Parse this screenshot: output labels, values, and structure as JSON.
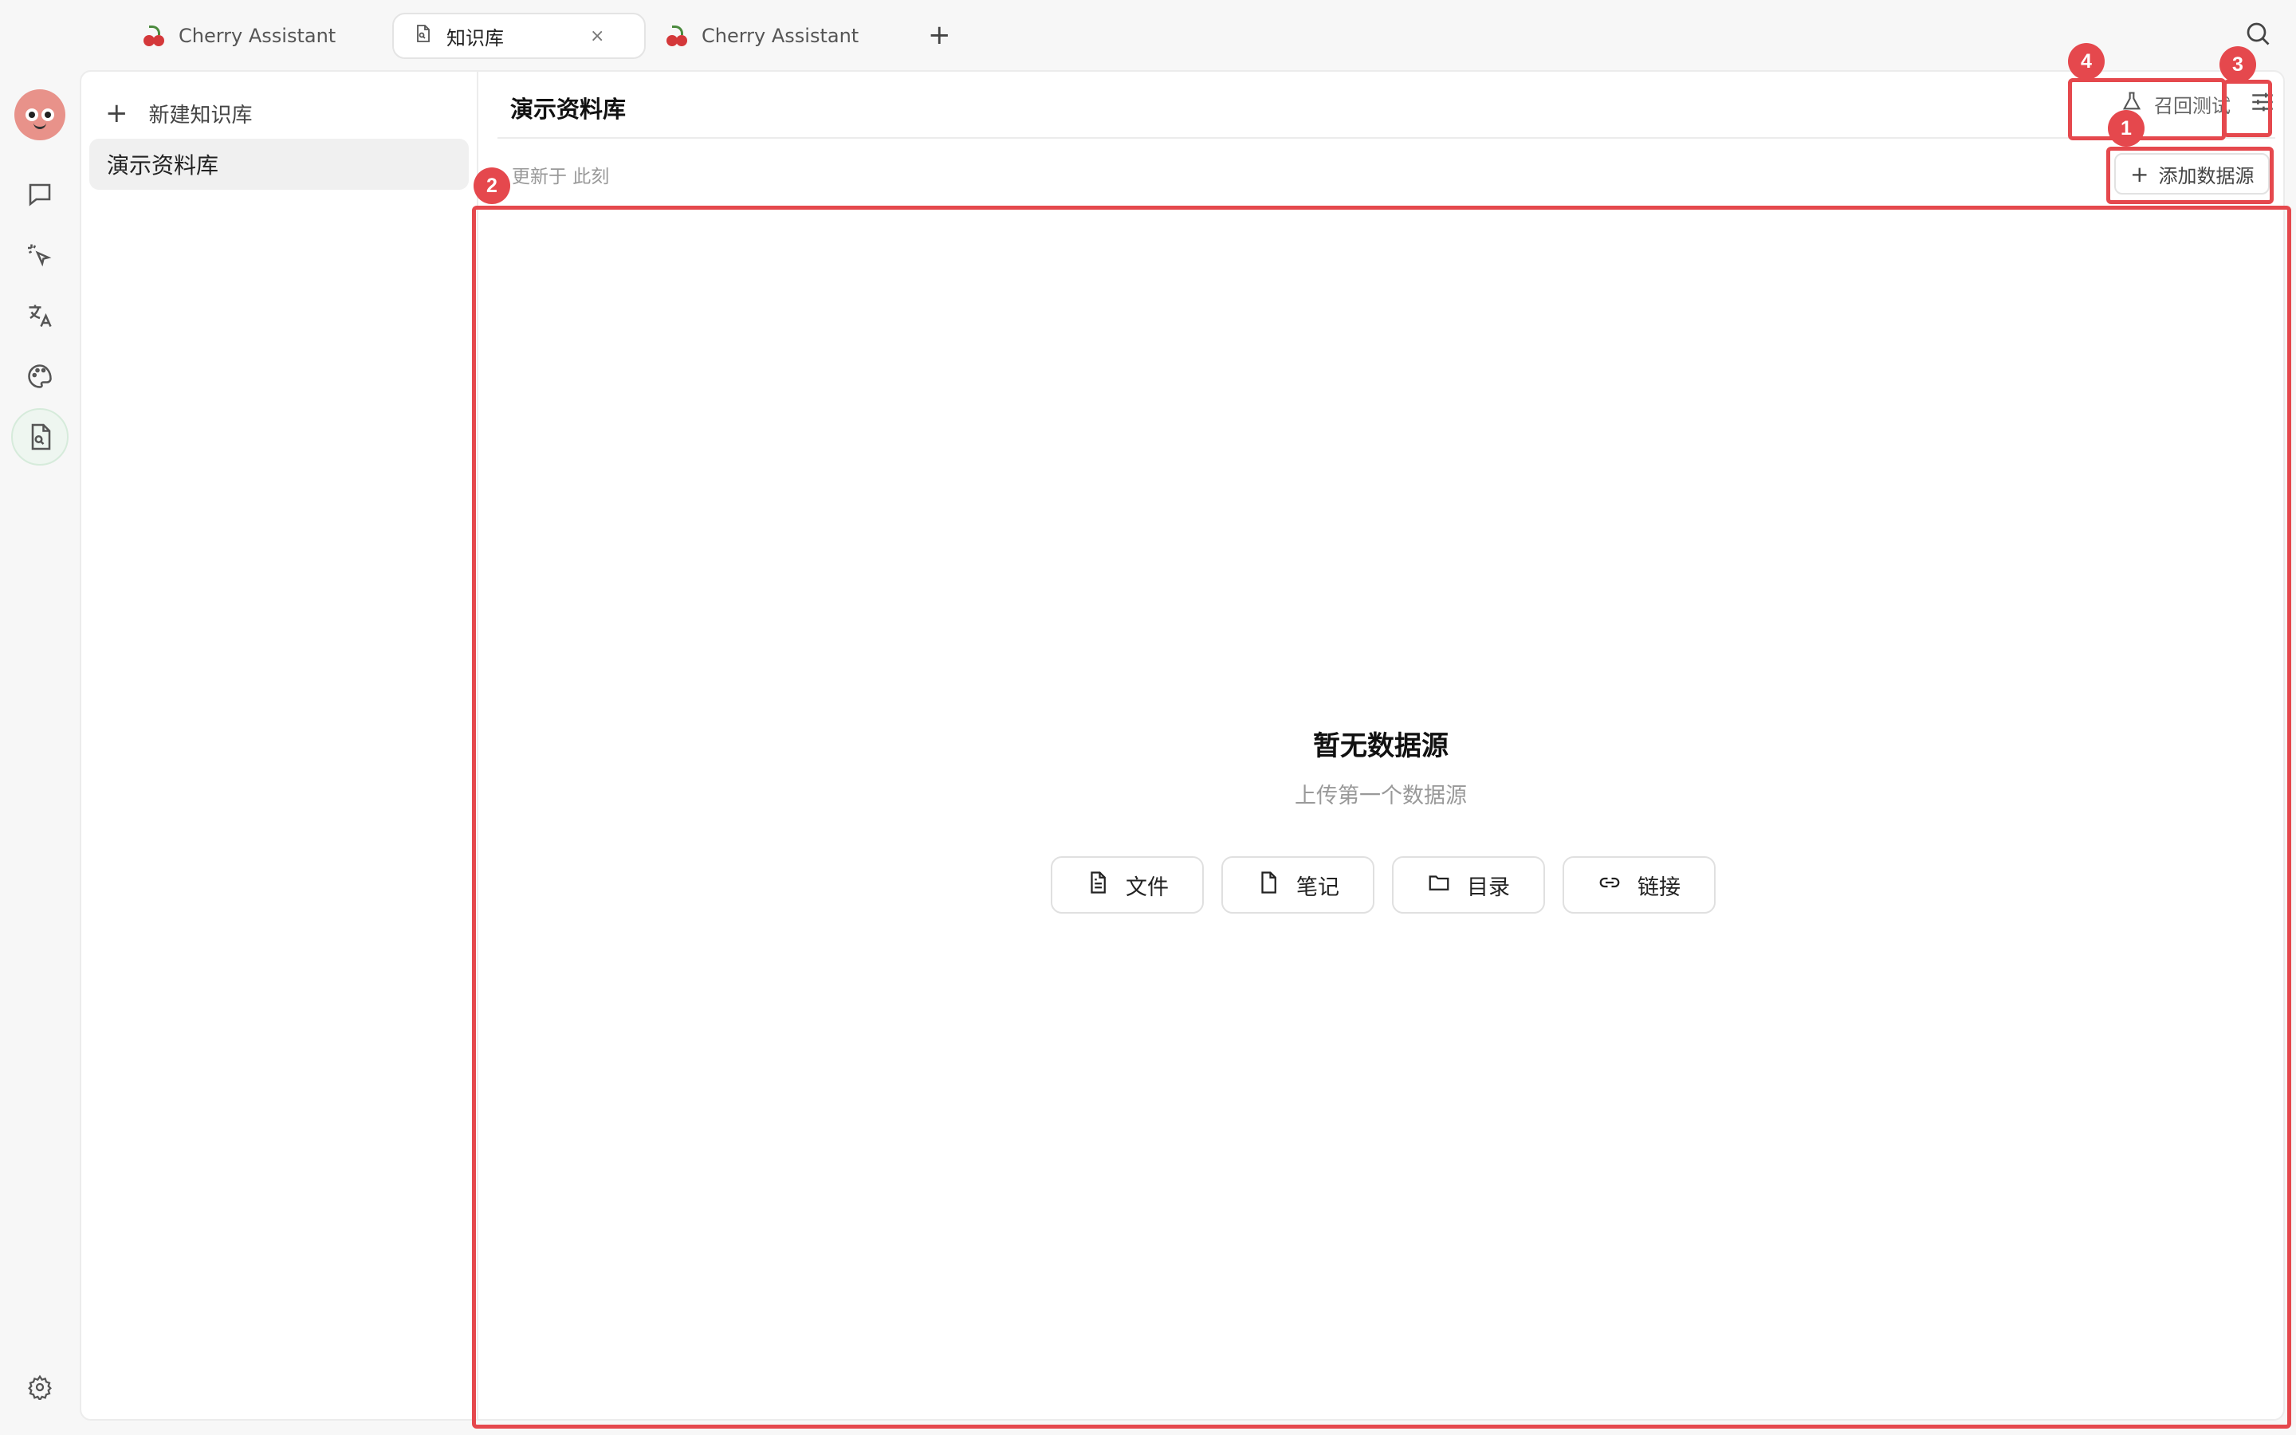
{
  "tabs": [
    {
      "label": "Cherry Assistant",
      "icon": "cherry-icon",
      "active": false
    },
    {
      "label": "知识库",
      "icon": "knowledge-file-icon",
      "active": true,
      "close_label": "×"
    },
    {
      "label": "Cherry Assistant",
      "icon": "cherry-icon",
      "active": false
    }
  ],
  "tabbar": {
    "add_tab_label": "+"
  },
  "sidebar": {
    "new_kb_label": "新建知识库",
    "items": [
      {
        "label": "演示资料库",
        "selected": true
      }
    ]
  },
  "kb": {
    "title": "演示资料库",
    "recall_test_label": "召回测试",
    "updated_text": "更新于 此刻",
    "add_source_label": "添加数据源"
  },
  "empty_state": {
    "title": "暂无数据源",
    "subtitle": "上传第一个数据源",
    "buttons": [
      {
        "label": "文件",
        "icon": "file-icon"
      },
      {
        "label": "笔记",
        "icon": "note-icon"
      },
      {
        "label": "目录",
        "icon": "folder-icon"
      },
      {
        "label": "链接",
        "icon": "link-icon"
      }
    ]
  },
  "annotations": [
    {
      "number": "1",
      "target": "add-source-button"
    },
    {
      "number": "2",
      "target": "data-source-area"
    },
    {
      "number": "3",
      "target": "kb-settings-button"
    },
    {
      "number": "4",
      "target": "recall-test-button"
    }
  ],
  "colors": {
    "annotation_red": "#e5484d",
    "active_rail": "#eef6f0"
  }
}
